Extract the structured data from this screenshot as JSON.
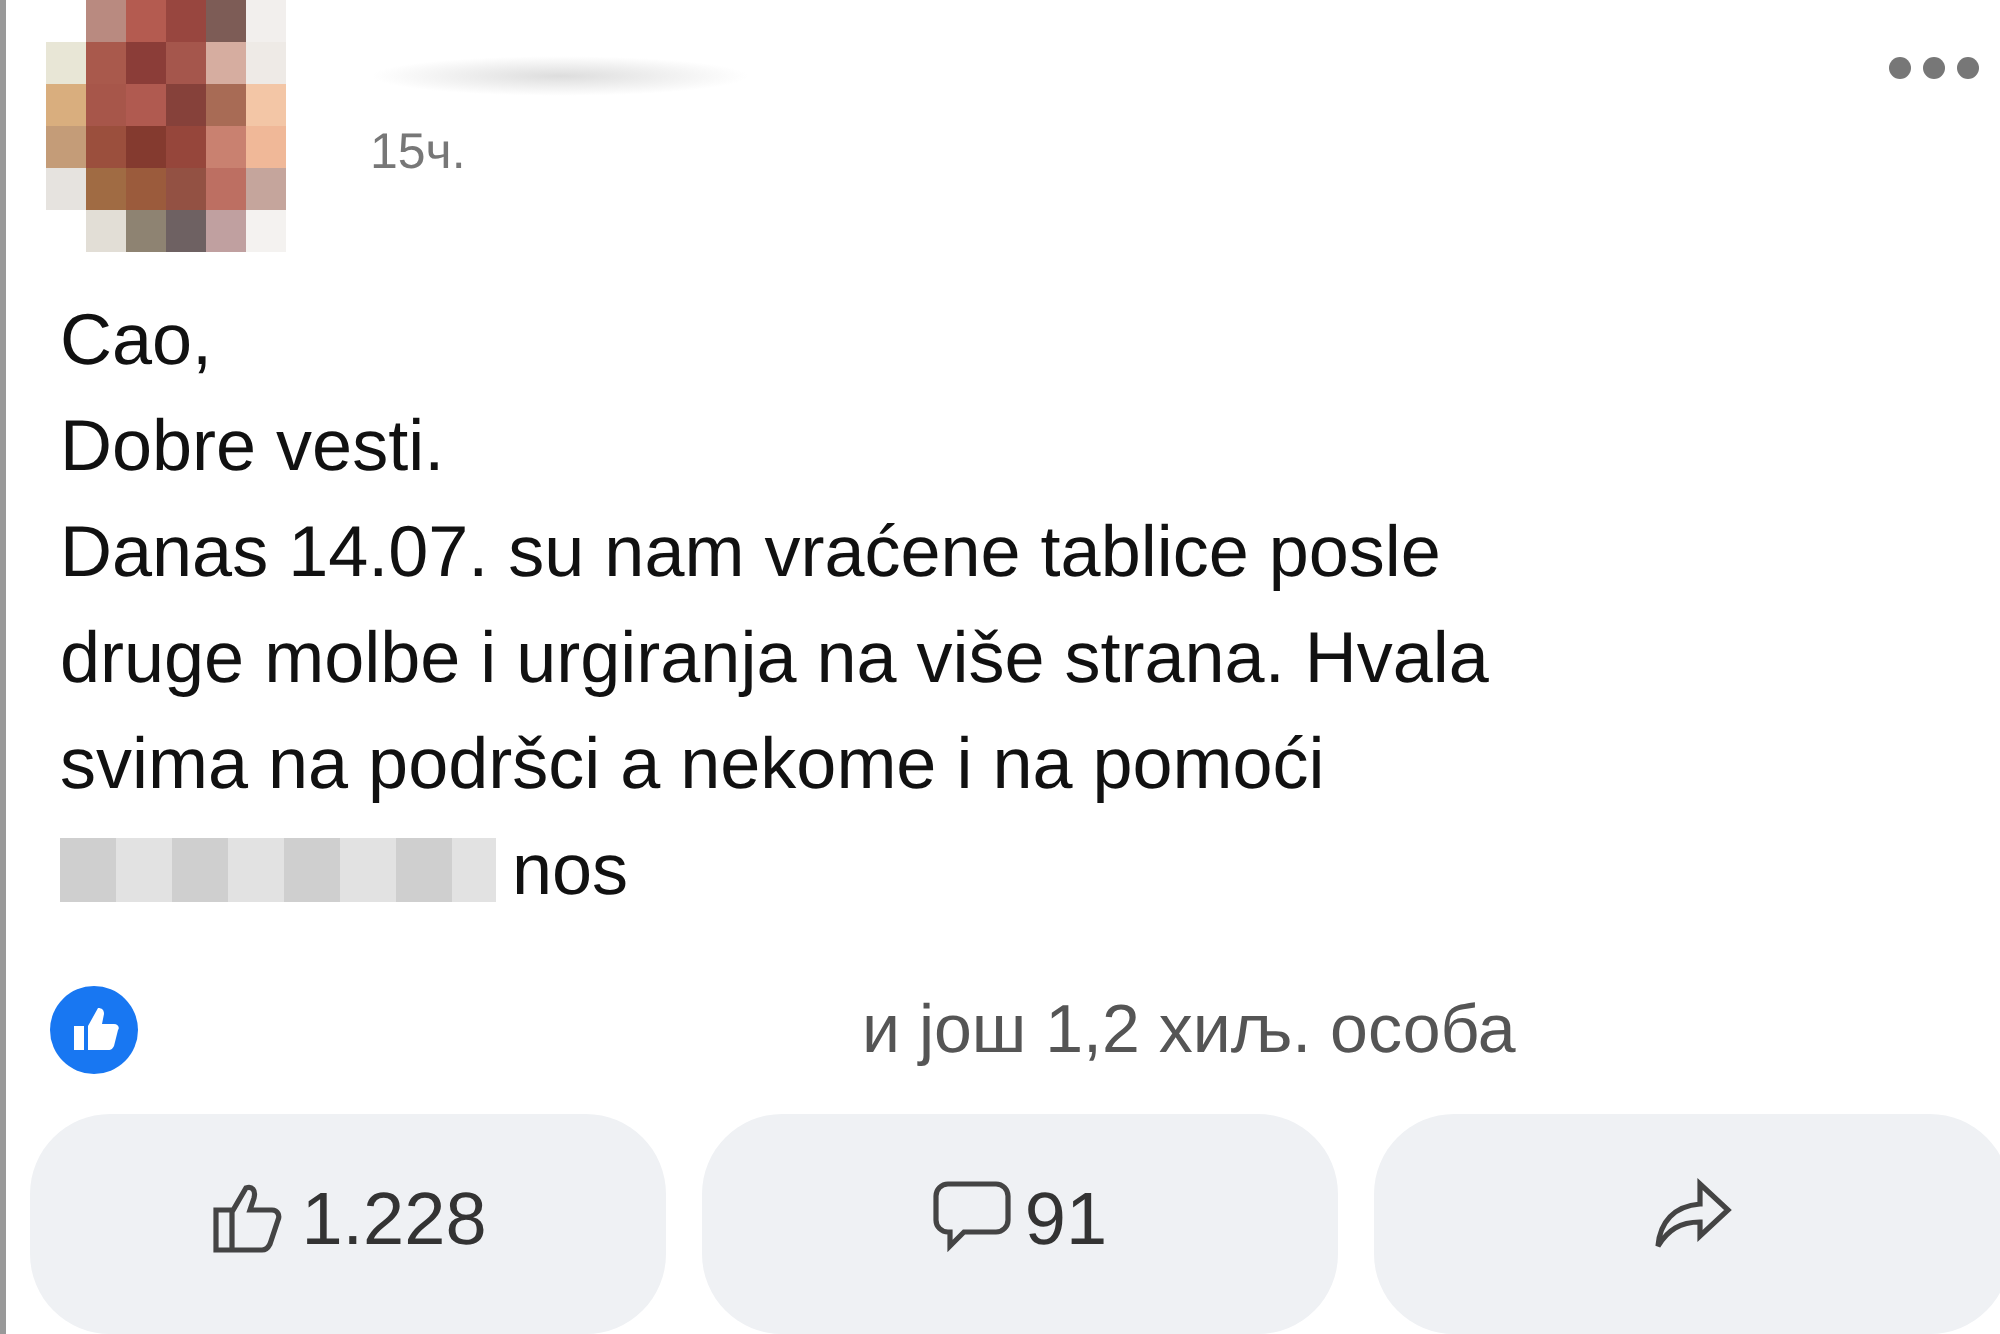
{
  "post": {
    "time": "15ч.",
    "lines": [
      "Cao,",
      "Dobre vesti.",
      "Danas 14.07. su nam vraćene tablice posle",
      "druge molbe i urgiranja na više strana. Hvala",
      "svima na podršci a nekome i na pomoći"
    ],
    "last_line_tail": "nos",
    "reactions_text": "и још 1,2 хиљ. особа",
    "actions": [
      {
        "kind": "like",
        "count": "1.228"
      },
      {
        "kind": "comment",
        "count": "91"
      },
      {
        "kind": "share"
      }
    ]
  }
}
